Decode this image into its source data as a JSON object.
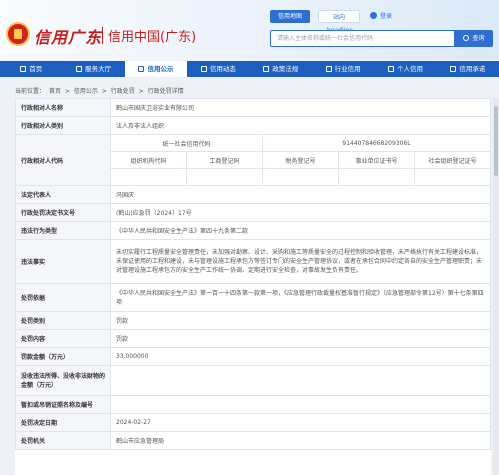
{
  "header": {
    "logo_script": "信用广东",
    "logo_title": "信用中国(广东)",
    "tab_active": "信用地图",
    "tab_plain": "站内headline",
    "login": "登录"
  },
  "search": {
    "placeholder": "请输入主体名称或统一社会信用代码",
    "button": "查询"
  },
  "nav": {
    "items": [
      "首页",
      "服务大厅",
      "信用公示",
      "信用动态",
      "政策法规",
      "行业信用",
      "个人信用",
      "信用承诺"
    ]
  },
  "breadcrumb": {
    "prefix": "当前位置：",
    "items": [
      "首页",
      "信用公示",
      "行政处罚",
      "行政处罚详情"
    ],
    "sep": ">"
  },
  "detail": {
    "name_label": "行政相对人名称",
    "name_value": "鹤山市国庆卫浴实业有限公司",
    "category_label": "行政相对人类别",
    "category_value": "法人及非法人组织",
    "code_label": "行政相对人代码",
    "uscc_label": "统一社会信用代码",
    "uscc_value": "91440784668209306L",
    "sub_headers": [
      "组织机构代码",
      "工商登记码",
      "税务登记号",
      "事业单位证书号",
      "社会组织登记证号"
    ],
    "legal_label": "法定代表人",
    "legal_value": "冯国庆",
    "doc_label": "行政处罚决定书文号",
    "doc_value": "(鹤山)应急罚〔2024〕17号",
    "type_label": "违法行为类型",
    "type_value": "《中华人民共和国安全生产法》第四十九条第二款",
    "fact_label": "违法事实",
    "fact_value": "未切实履行工程质量安全管理责任，未加强对勘察、设计、采购和施工等质量安全的过程控制和验收管理，未严格执行有关工程建设标准，未保证使用的工程和建设，未与管理设施工程承包方等签订专门的安全生产管理协议，或者在承包合同中约定各自的安全生产管理职责；未对管理设施工程承包方的安全生产工作统一协调、定期进行安全检查，对事故发生负有责任。",
    "basis_label": "处罚依据",
    "basis_value": "《中华人民共和国安全生产法》第一百一十四条第一款第一项，《应急管理行政裁量权基准暂行规定》（应急管理部令第12号）第十七条第四项",
    "category2_label": "处罚类别",
    "category2_value": "罚款",
    "content_label": "处罚内容",
    "content_value": "罚款",
    "fine_label": "罚款金额（万元）",
    "fine_value": "33.000000",
    "confiscate_label": "没收违法所得、没收非法财物的金额（万元）",
    "confiscate_value": "",
    "license_label": "暂扣或吊销证照名称及编号",
    "license_value": "",
    "date_label": "处罚决定日期",
    "date_value": "2024-02-27",
    "org_label": "处罚机关",
    "org_value": "鹤山市应急管理局"
  }
}
